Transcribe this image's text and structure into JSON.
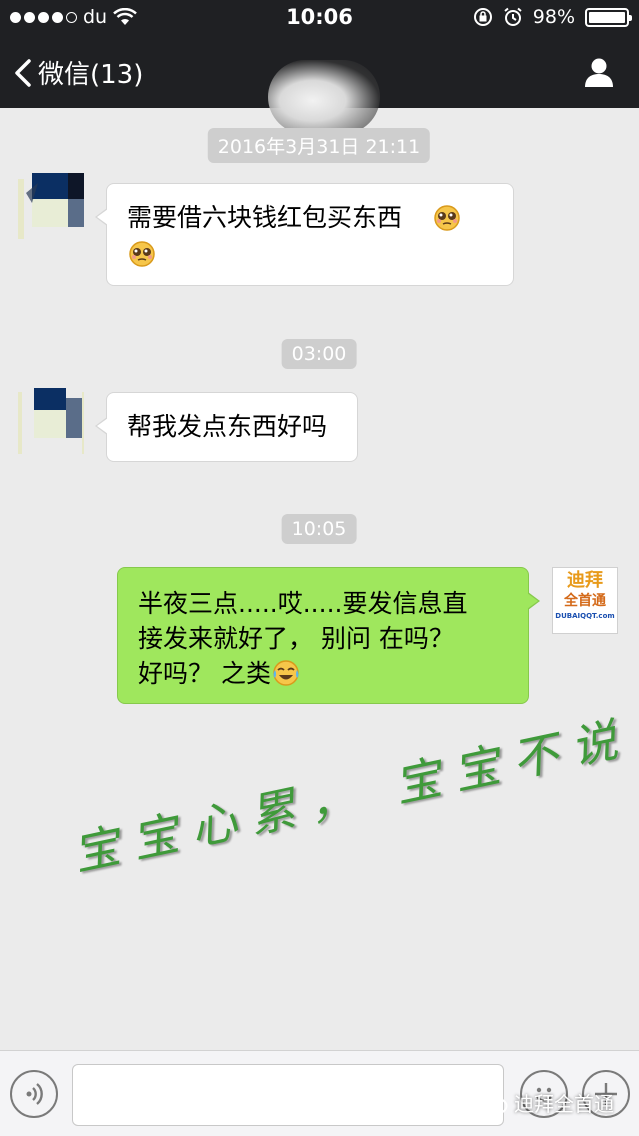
{
  "status_bar": {
    "carrier": "du",
    "time": "10:06",
    "battery": "98%",
    "battery_level": 0.98
  },
  "nav": {
    "back_label": "微信(13)"
  },
  "messages": [
    {
      "type": "timestamp",
      "text": "2016年3月31日 21:11"
    },
    {
      "type": "incoming",
      "text": "需要借六块钱红包买东西"
    },
    {
      "type": "timestamp",
      "text": "03:00"
    },
    {
      "type": "incoming",
      "text": "帮我发点东西好吗"
    },
    {
      "type": "timestamp",
      "text": "10:05"
    },
    {
      "type": "outgoing",
      "lines": [
        "半夜三点.....哎.....要发信息直",
        "接发来就好了， 别问 在吗？",
        "好吗？ 之类"
      ]
    }
  ],
  "self_avatar": {
    "line1": "迪拜",
    "line2": "全首通",
    "line3": "DUBAIQQT.com"
  },
  "handwriting": "宝宝心累， 宝宝不说",
  "watermark": "迪拜全首通",
  "colors": {
    "header": "#1f2023",
    "chat_bg": "#ebebeb",
    "outgoing_bubble": "#9fe75d",
    "incoming_bubble": "#ffffff",
    "timestamp_bg": "#cecece",
    "handwriting": "#3f9a3a"
  }
}
